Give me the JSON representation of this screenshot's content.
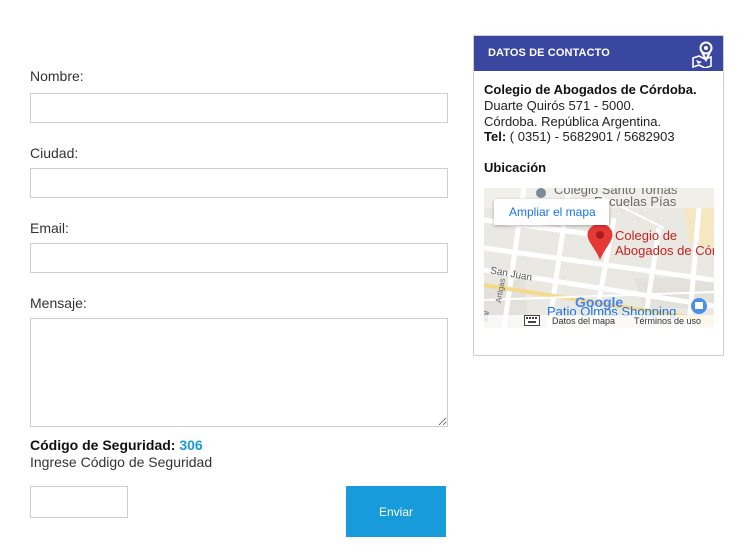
{
  "form": {
    "name_label": "Nombre:",
    "name_value": "",
    "city_label": "Ciudad:",
    "city_value": "",
    "email_label": "Email:",
    "email_value": "",
    "message_label": "Mensaje:",
    "message_value": "",
    "security_label": "Código de Seguridad:",
    "security_code": "306",
    "security_hint": "Ingrese Código de Seguridad",
    "security_value": "",
    "submit_label": "Enviar"
  },
  "contact": {
    "header_title": "DATOS DE CONTACTO",
    "header_icon": "map-pin-icon",
    "org_name": "Colegio de Abogados de Córdoba.",
    "address_line1": "Duarte Quirós 571 - 5000.",
    "address_line2": "Córdoba. República Argentina.",
    "tel_label": "Tel:",
    "tel_value": "( 0351) - 5682901 / 5682903",
    "location_title": "Ubicación"
  },
  "map": {
    "enlarge_label": "Ampliar el mapa",
    "place_label_line1": "Colegio de",
    "place_label_line2": "Abogados de Córdo",
    "poi_top": "Colegio Santo Tomás",
    "poi_top2": "Escuelas Pías",
    "street_san_juan": "San Juan",
    "street_artigas": "Artigas",
    "street_tral": "tral",
    "poi_shopping": "Patio Olmos Shopping",
    "google_logo": "Google",
    "map_data": "Datos del mapa",
    "terms": "Términos de uso",
    "keyboard_icon": "keyboard-icon",
    "marker_icon": "map-marker-icon"
  },
  "colors": {
    "header_bg": "#3a47a0",
    "button_bg": "#179bdb",
    "code_accent": "#1a9ad6",
    "marker": "#e53935"
  }
}
